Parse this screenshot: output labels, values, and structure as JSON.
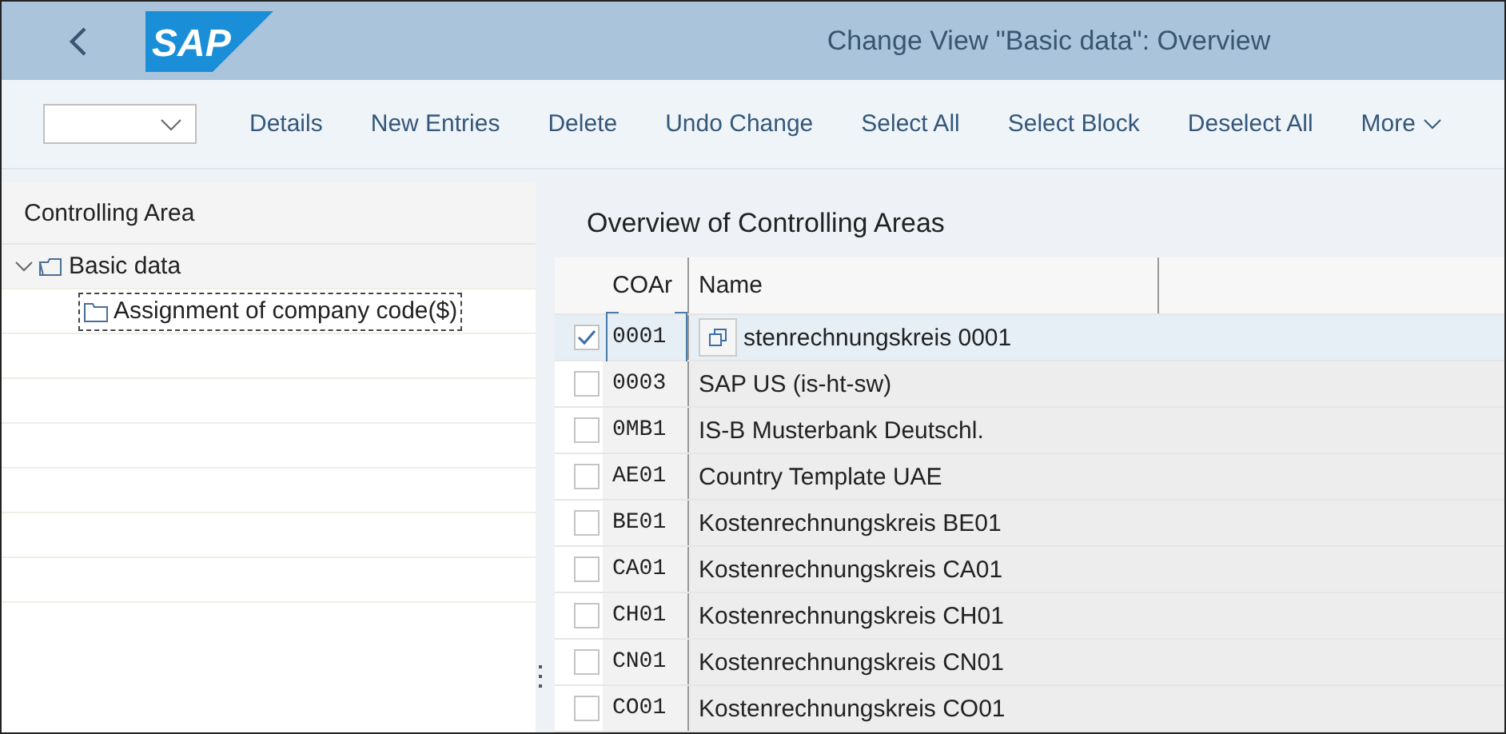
{
  "header": {
    "logo": "SAP",
    "title": "Change View \"Basic data\": Overview"
  },
  "toolbar": {
    "buttons": [
      "Details",
      "New Entries",
      "Delete",
      "Undo Change",
      "Select All",
      "Select Block",
      "Deselect All"
    ],
    "more": "More"
  },
  "tree": {
    "title": "Controlling Area",
    "items": [
      {
        "label": "Basic data",
        "expanded": true,
        "selected": true,
        "focused": false,
        "children": [
          {
            "label": "Assignment of company code($)",
            "selected": false,
            "focused": true
          }
        ]
      }
    ]
  },
  "table": {
    "title": "Overview of Controlling Areas",
    "columns": [
      "COAr",
      "Name"
    ],
    "rows": [
      {
        "coar": "0001",
        "name": "stenrechnungskreis 0001",
        "selected": true,
        "focused": true
      },
      {
        "coar": "0003",
        "name": "SAP US (is-ht-sw)",
        "selected": false,
        "focused": false
      },
      {
        "coar": "0MB1",
        "name": "IS-B Musterbank Deutschl.",
        "selected": false,
        "focused": false
      },
      {
        "coar": "AE01",
        "name": "Country Template UAE",
        "selected": false,
        "focused": false
      },
      {
        "coar": "BE01",
        "name": "Kostenrechnungskreis BE01",
        "selected": false,
        "focused": false
      },
      {
        "coar": "CA01",
        "name": "Kostenrechnungskreis CA01",
        "selected": false,
        "focused": false
      },
      {
        "coar": "CH01",
        "name": "Kostenrechnungskreis CH01",
        "selected": false,
        "focused": false
      },
      {
        "coar": "CN01",
        "name": "Kostenrechnungskreis CN01",
        "selected": false,
        "focused": false
      },
      {
        "coar": "CO01",
        "name": "Kostenrechnungskreis CO01",
        "selected": false,
        "focused": false
      }
    ]
  }
}
